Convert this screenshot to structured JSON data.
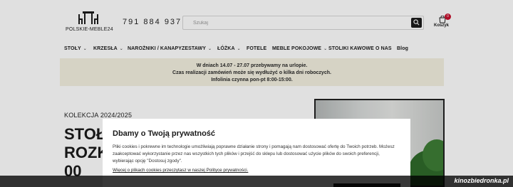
{
  "header": {
    "logo_text": "POLSKIE-MEBLE24",
    "phone": "791 884 937",
    "search": {
      "placeholder": "Szukaj"
    },
    "cart": {
      "label": "Koszyk",
      "count": "0"
    }
  },
  "nav": {
    "items": [
      {
        "label": "STOŁY",
        "dropdown": "⌄"
      },
      {
        "label": "KRZESŁA",
        "dropdown": "⌄"
      },
      {
        "label": "NAROŻNIKI / KANAPY"
      },
      {
        "label": "ZESTAWY",
        "dropdown": "⌄"
      },
      {
        "label": "ŁÓŻKA",
        "dropdown": "⌄"
      },
      {
        "label": "FOTELE"
      },
      {
        "label": "MEBLE POKOJOWE",
        "dropdown": "⌄"
      },
      {
        "label": "STOLIKI KAWOWE"
      },
      {
        "label": "O NAS"
      },
      {
        "label": "Blog"
      }
    ]
  },
  "notice": {
    "line1": "W dniach 14.07 - 27.07 przebywamy na urlopie.",
    "line2": "Czas realizacji zamówień może się wydłużyć o kilka dni roboczych.",
    "line3": "Infolinia czynna pon-pt 8:00-15:00."
  },
  "hero": {
    "collection": "KOLEKCJA 2024/2025",
    "title_lines": [
      "STOŁ",
      "ROZK",
      "00"
    ]
  },
  "cookie_modal": {
    "title": "Dbamy o Twoją prywatność",
    "text": "Pliki cookies i pokrewne im technologie umożliwiają poprawne działanie strony i pomagają nam dostosować ofertę do Twoich potrzeb. Możesz zaakceptować wykorzystanie przez nas wszystkich tych plików i przejść do sklepu lub dostosować użycie plików do swoich preferencji, wybierając opcję \"Dostosuj zgody\".",
    "link": "Więcej o plikach cookies przeczytasz w naszej Polityce prywatności."
  },
  "watermark": "kinozbiedronka.pl",
  "colors": {
    "accent_dark": "#1b1b1b",
    "notice_bg": "#f4f1e1",
    "badge_red": "#c8102e"
  }
}
